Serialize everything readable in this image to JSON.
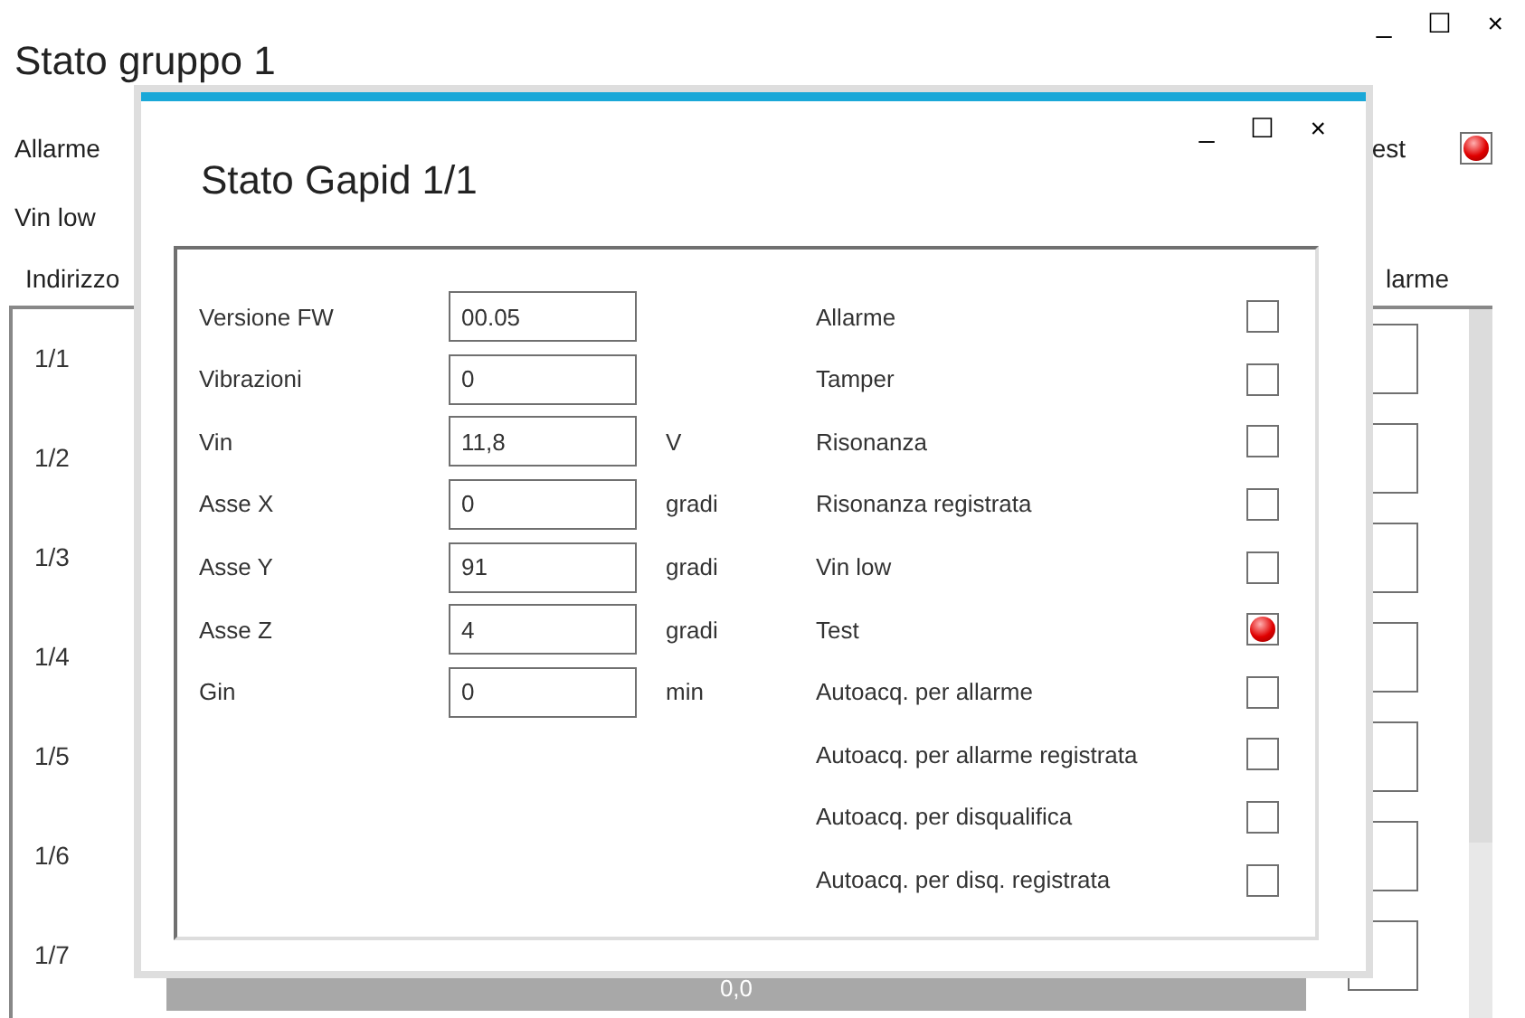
{
  "window": {
    "title": "Stato gruppo 1",
    "controls": [
      "_",
      "☐",
      "×"
    ]
  },
  "status_labels": [
    {
      "label": "Allarme"
    },
    {
      "label": "Vin low"
    }
  ],
  "test_indicator": {
    "label": "est",
    "on": true
  },
  "table": {
    "columns": [
      "Indirizzo",
      "larme"
    ],
    "rows": [
      {
        "address": "1/1",
        "checked": false
      },
      {
        "address": "1/2",
        "checked": false
      },
      {
        "address": "1/3",
        "checked": false
      },
      {
        "address": "1/4",
        "checked": false
      },
      {
        "address": "1/5",
        "checked": false
      },
      {
        "address": "1/6",
        "checked": false
      },
      {
        "address": "1/7",
        "checked": false,
        "value": "0,0"
      }
    ]
  },
  "dialog": {
    "title": "Stato Gapid 1/1",
    "controls": [
      "_",
      "☐",
      "×"
    ],
    "fields": [
      {
        "label": "Versione FW",
        "value": "00.05"
      },
      {
        "label": "Vibrazioni",
        "value": "0"
      },
      {
        "label": "Vin",
        "value": "11,8",
        "unit": "V"
      },
      {
        "label": "Asse X",
        "value": "0",
        "unit": "gradi"
      },
      {
        "label": "Asse Y",
        "value": "91",
        "unit": "gradi"
      },
      {
        "label": "Asse Z",
        "value": "4",
        "unit": "gradi"
      },
      {
        "label": "Gin",
        "value": "0",
        "unit": "min"
      }
    ],
    "flags": [
      {
        "label": "Allarme",
        "kind": "checkbox",
        "checked": false
      },
      {
        "label": "Tamper",
        "kind": "checkbox",
        "checked": false
      },
      {
        "label": "Risonanza",
        "kind": "checkbox",
        "checked": false
      },
      {
        "label": "Risonanza registrata",
        "kind": "checkbox",
        "checked": false
      },
      {
        "label": "Vin low",
        "kind": "checkbox",
        "checked": false
      },
      {
        "label": "Test",
        "kind": "led",
        "checked": true
      },
      {
        "label": "Autoacq. per allarme",
        "kind": "checkbox",
        "checked": false
      },
      {
        "label": "Autoacq. per allarme registrata",
        "kind": "checkbox",
        "checked": false
      },
      {
        "label": "Autoacq. per disqualifica",
        "kind": "checkbox",
        "checked": false
      },
      {
        "label": "Autoacq. per disq. registrata",
        "kind": "checkbox",
        "checked": false
      }
    ]
  }
}
